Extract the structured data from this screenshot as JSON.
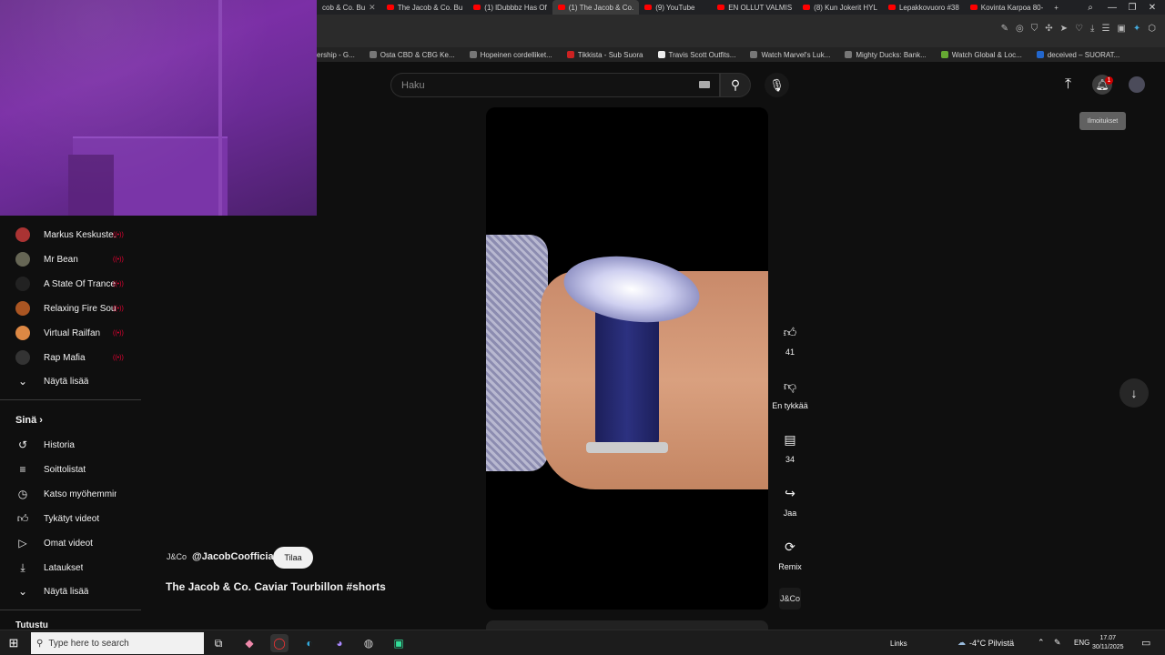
{
  "browser": {
    "tabs": [
      {
        "label": "cob & Co. Bu",
        "icon": "tab-icon"
      },
      {
        "label": "The Jacob & Co. Bu",
        "icon": "youtube-icon"
      },
      {
        "label": "(1) lDubbbz Has Of",
        "icon": "youtube-icon"
      },
      {
        "label": "(1) The Jacob & Co.",
        "icon": "youtube-icon",
        "active": true
      },
      {
        "label": "(9) YouTube",
        "icon": "youtube-icon"
      },
      {
        "label": "EN OLLUT VALMIS",
        "icon": "youtube-icon"
      },
      {
        "label": "(8) Kun Jokerit HYL",
        "icon": "youtube-icon"
      },
      {
        "label": "Lepakkovuoro #38",
        "icon": "youtube-icon"
      },
      {
        "label": "Kovinta Karpoa 80-",
        "icon": "youtube-icon"
      }
    ],
    "new_tab": "+",
    "bookmarks": [
      {
        "label": "ership - G..."
      },
      {
        "label": "Osta CBD & CBG Ke..."
      },
      {
        "label": "Hopeinen cordelliket..."
      },
      {
        "label": "Tikkista - Sub Suora"
      },
      {
        "label": "Travis Scott Outfits..."
      },
      {
        "label": "Watch Marvel's Luk..."
      },
      {
        "label": "Mighty Ducks: Bank..."
      },
      {
        "label": "Watch Global & Loc..."
      },
      {
        "label": "deceived – SUORAT..."
      }
    ]
  },
  "header": {
    "search_placeholder": "Haku",
    "notifications_badge": "1",
    "tooltip": "Ilmoitukset"
  },
  "sidebar": {
    "subscriptions": [
      {
        "label": "Markus Keskuste...",
        "avatar_color": "#a33"
      },
      {
        "label": "Mr Bean",
        "avatar_color": "#665"
      },
      {
        "label": "A State Of Trance",
        "avatar_color": "#222"
      },
      {
        "label": "Relaxing Fire Sou...",
        "avatar_color": "#a52"
      },
      {
        "label": "Virtual Railfan",
        "avatar_color": "#d84"
      },
      {
        "label": "Rap Mafia",
        "avatar_color": "#333"
      }
    ],
    "show_more": "Näytä lisää",
    "you_section": "Sinä",
    "you_items": [
      {
        "label": "Historia",
        "icon": "history-icon"
      },
      {
        "label": "Soittolistat",
        "icon": "playlist-icon"
      },
      {
        "label": "Katso myöhemmin",
        "icon": "clock-icon"
      },
      {
        "label": "Tykätyt videot",
        "icon": "thumbs-up-icon"
      },
      {
        "label": "Omat videot",
        "icon": "video-icon"
      },
      {
        "label": "Lataukset",
        "icon": "download-icon"
      }
    ],
    "show_more_2": "Näytä lisää",
    "next_section": "Tutustu"
  },
  "video": {
    "channel": "@JacobCoofficial",
    "subscribe": "Tilaa",
    "title": "The Jacob & Co. Caviar Tourbillon #shorts",
    "channel_logo": "J&Co"
  },
  "actions": {
    "like_count": "41",
    "dislike_label": "En tykkää",
    "comments_count": "34",
    "share_label": "Jaa",
    "remix_label": "Remix"
  },
  "taskbar": {
    "search_placeholder": "Type here to search",
    "links": "Links",
    "weather": "-4°C Pilvistä",
    "lang": "ENG",
    "time": "17.07",
    "date": "30/11/2025"
  },
  "colors": {
    "background": "#0f0f0f",
    "youtube_red": "#ff0000",
    "strap_blue": "#2c3180"
  }
}
